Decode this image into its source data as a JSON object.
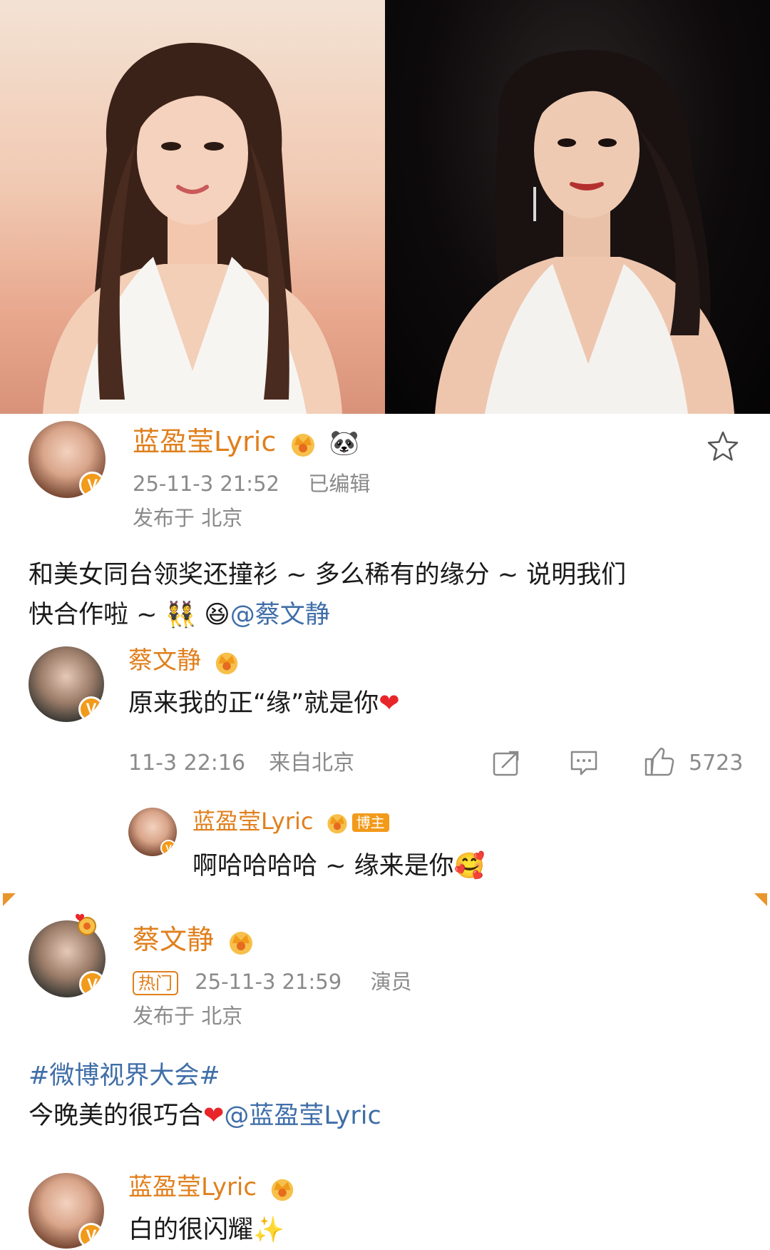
{
  "post1": {
    "username": "蓝盈莹Lyric",
    "emoji_panda": "🐼",
    "time": "25-11-3 21:52",
    "edited": "已编辑",
    "location": "发布于 北京",
    "text_part1": "和美女同台领奖还撞衫 ~ 多么稀有的缘分 ~ 说明我们",
    "text_part2": "快合作啦 ~ 👯 😆",
    "mention": "@蔡文静",
    "icons": [
      "star-icon",
      "crown-icon",
      "panda-icon"
    ]
  },
  "comment1": {
    "username": "蔡文静",
    "text": "原来我的正“缘”就是你",
    "heart": "❤",
    "time": "11-3 22:16",
    "source": "来自北京",
    "likes": "5723",
    "icons": [
      "share-icon",
      "comment-icon",
      "like-icon"
    ]
  },
  "reply1": {
    "username": "蓝盈莹Lyric",
    "badge": "博主",
    "text": "啊哈哈哈哈 ~ 缘来是你",
    "emoji": "🥰"
  },
  "post2": {
    "username": "蔡文静",
    "hot": "热门",
    "time": "25-11-3 21:59",
    "role": "演员",
    "location": "发布于 北京",
    "hashtag": "#微博视界大会#",
    "text": "今晚美的很巧合",
    "heart": "❤",
    "mention": "@蓝盈莹Lyric"
  },
  "comment2": {
    "username": "蓝盈莹Lyric",
    "text": "白的很闪耀",
    "emoji": "✨"
  },
  "colors": {
    "username": "#e07f1c",
    "mention": "#3f6ea8",
    "meta": "#8a8a8a",
    "verified": "#f29a1a",
    "heart": "#e8262a"
  }
}
